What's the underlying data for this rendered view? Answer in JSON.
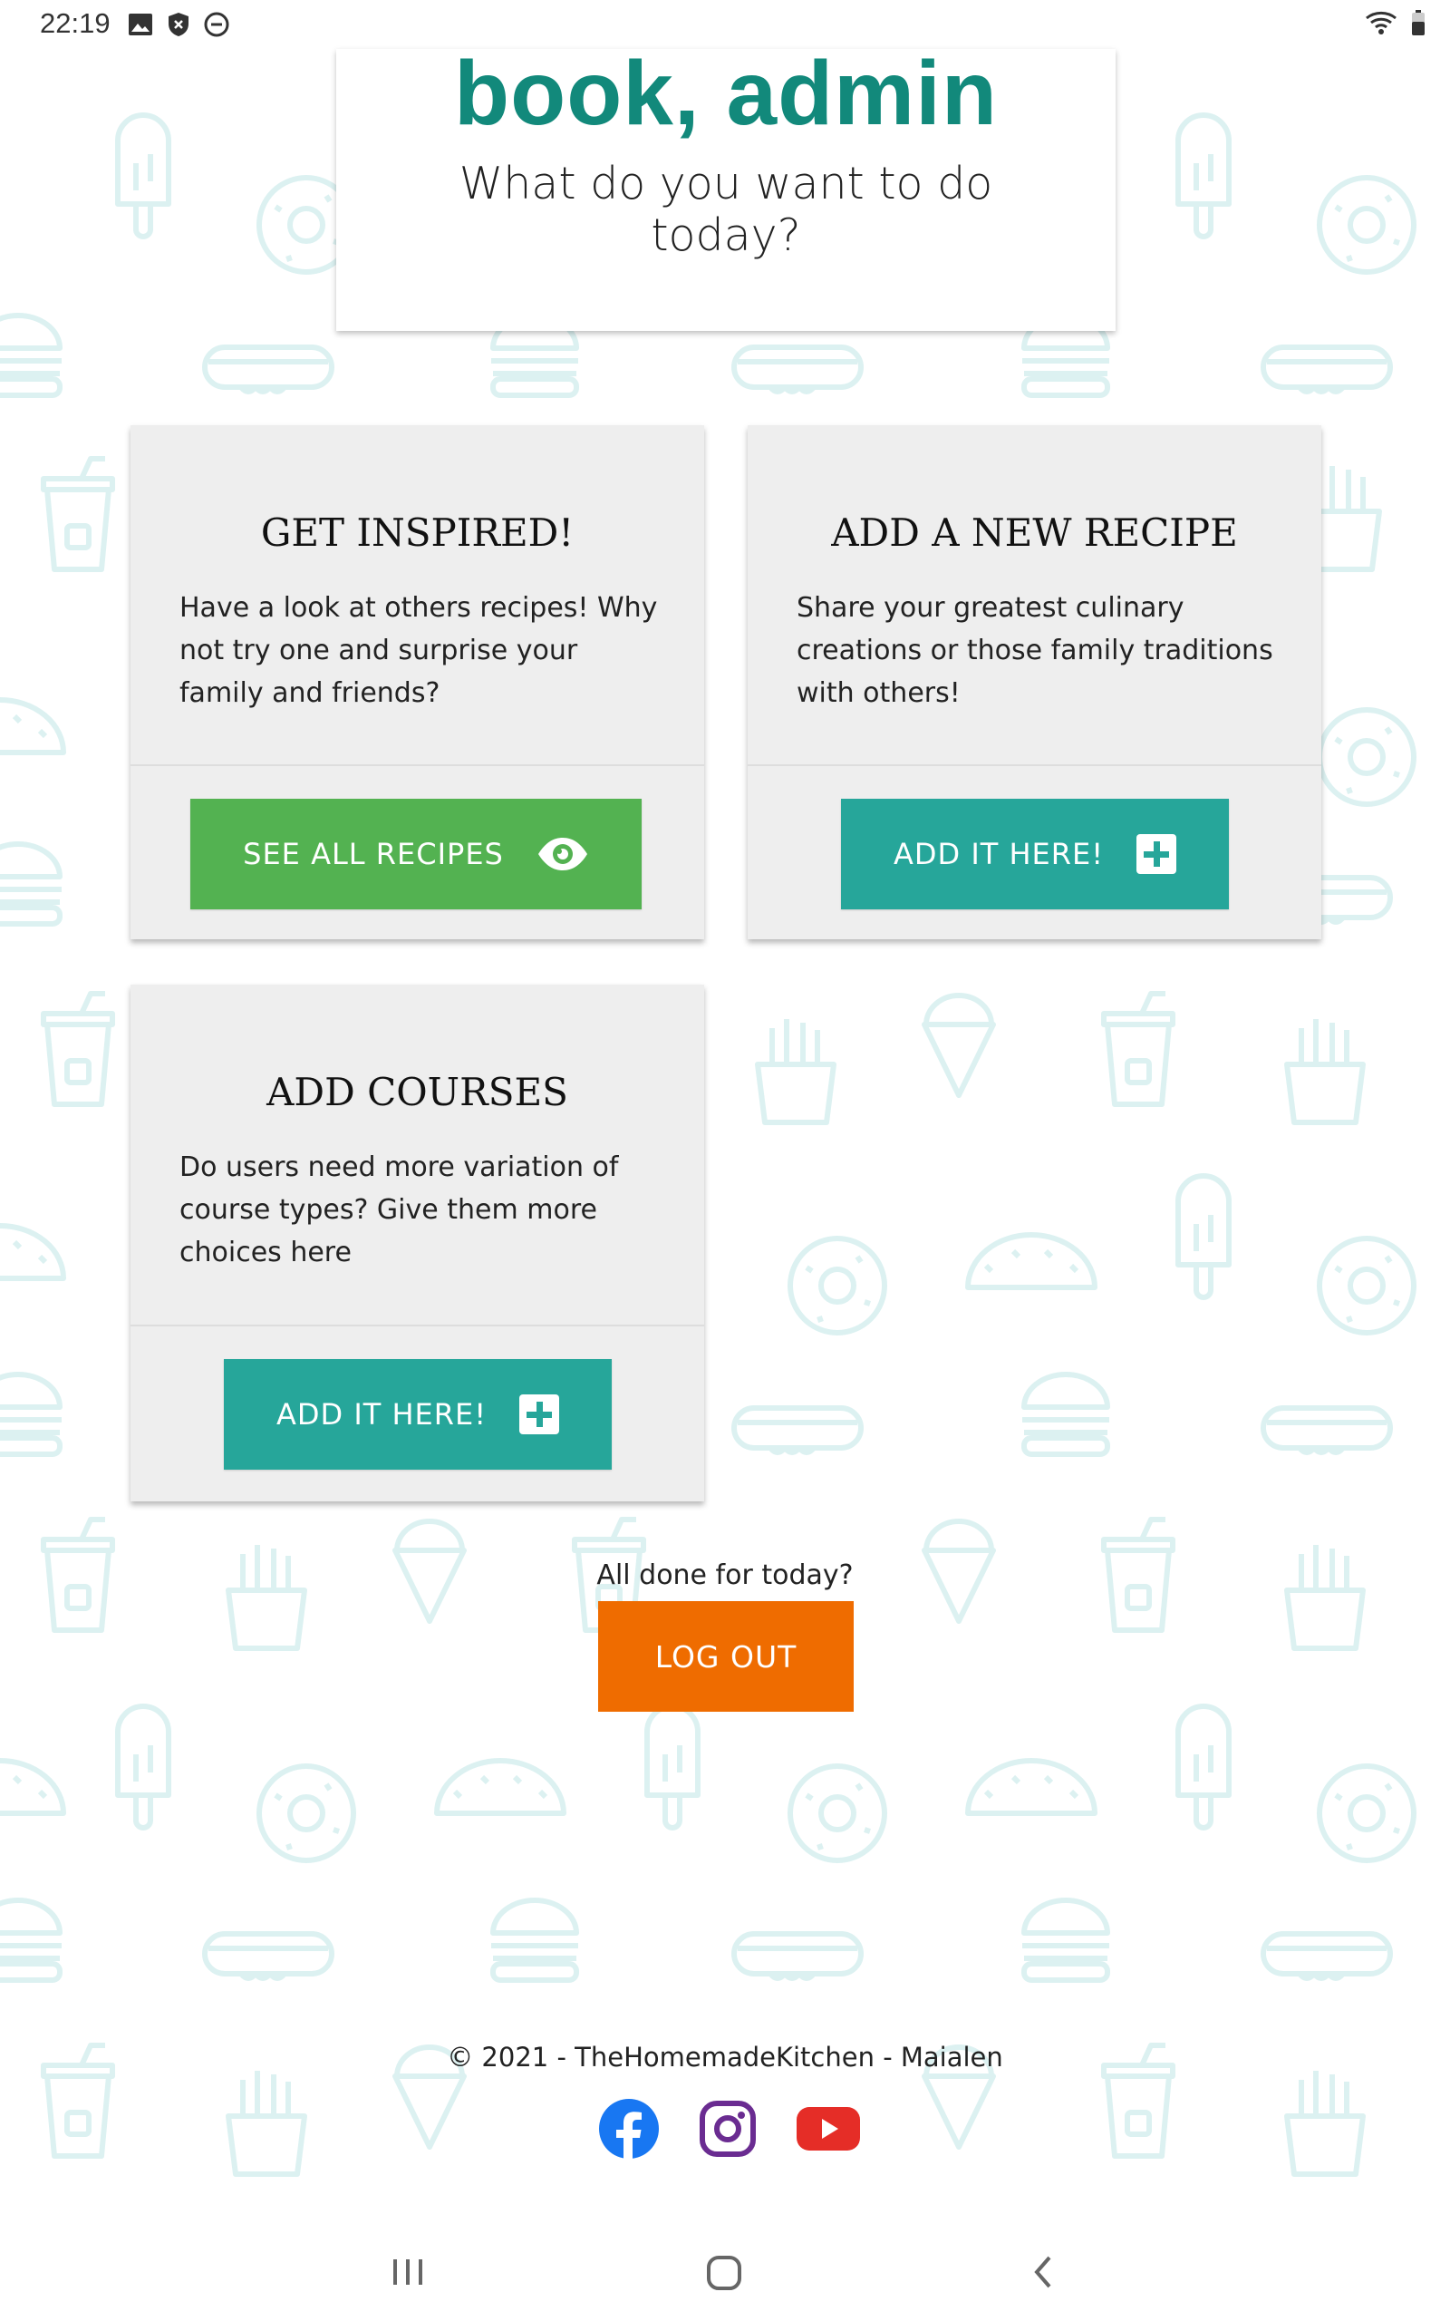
{
  "status_bar": {
    "time": "22:19",
    "left_icons": [
      "image-icon",
      "shield-icon",
      "dnd-icon"
    ],
    "right_icons": [
      "wifi-icon",
      "battery-icon"
    ]
  },
  "welcome": {
    "title": "book, admin",
    "subtitle": "What do you want to do today?"
  },
  "cards": [
    {
      "title": "GET INSPIRED!",
      "text": "Have a look at others recipes! Why not try one and surprise your family and friends?",
      "button_label": "SEE ALL RECIPES",
      "button_icon": "eye-icon",
      "button_color": "#53b251"
    },
    {
      "title": "ADD A NEW RECIPE",
      "text": "Share your greatest culinary creations or those family traditions with others!",
      "button_label": "ADD IT HERE!",
      "button_icon": "plus-square-icon",
      "button_color": "#26a69a"
    },
    {
      "title": "ADD COURSES",
      "text": "Do users need more variation of course types? Give them more choices here",
      "button_label": "ADD IT HERE!",
      "button_icon": "plus-square-icon",
      "button_color": "#26a69a"
    }
  ],
  "logout": {
    "prompt": "All done for today?",
    "button_label": "LOG OUT",
    "button_color": "#ef6c00"
  },
  "footer": {
    "copyright": "© 2021 - TheHomemadeKitchen - Maialen",
    "social": [
      "facebook-icon",
      "instagram-icon",
      "youtube-icon"
    ]
  },
  "nav_bar": {
    "buttons": [
      "recent-apps-icon",
      "home-icon",
      "back-icon"
    ]
  },
  "colors": {
    "brand_teal": "#12897b",
    "pattern": "#dff3f3"
  }
}
